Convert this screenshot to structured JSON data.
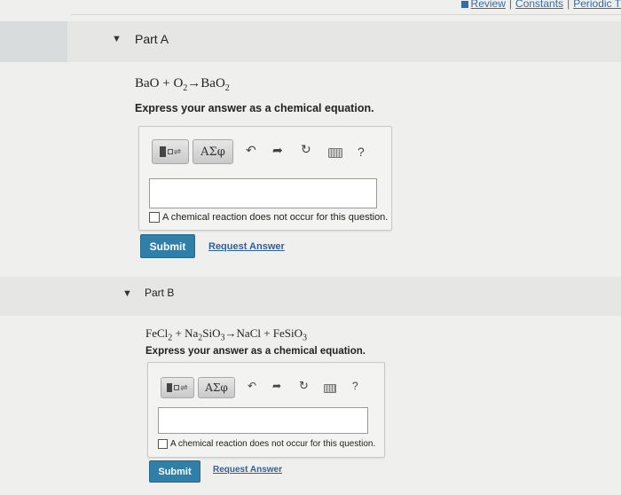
{
  "top_links": {
    "review": "Review",
    "constants": "Constants",
    "periodic": "Periodic T",
    "sep1": "|",
    "sep2": "|"
  },
  "toggle_glyph": "▼",
  "part_a": {
    "title": "Part A",
    "eq_lhs_1": "BaO",
    "eq_plus": " + O",
    "eq_sub_1": "2",
    "eq_arrow": "→",
    "eq_rhs": "BaO",
    "eq_sub_2": "2",
    "instruction": "Express your answer as a chemical equation.",
    "greek_label": "ΑΣφ",
    "help": "?",
    "no_reaction": "A chemical reaction does not occur for this question.",
    "submit": "Submit",
    "request_answer": "Request Answer"
  },
  "part_b": {
    "title": "Part B",
    "e1": "FeCl",
    "s1": "2",
    "e2": " + Na",
    "s2": "2",
    "e3": "SiO",
    "s3": "3",
    "e4": "→NaCl + FeSiO",
    "s4": "3",
    "instruction": "Express your answer as a chemical equation.",
    "greek_label": "ΑΣφ",
    "help": "?",
    "no_reaction": "A chemical reaction does not occur for this question.",
    "submit": "Submit",
    "request_answer": "Request Answer"
  }
}
